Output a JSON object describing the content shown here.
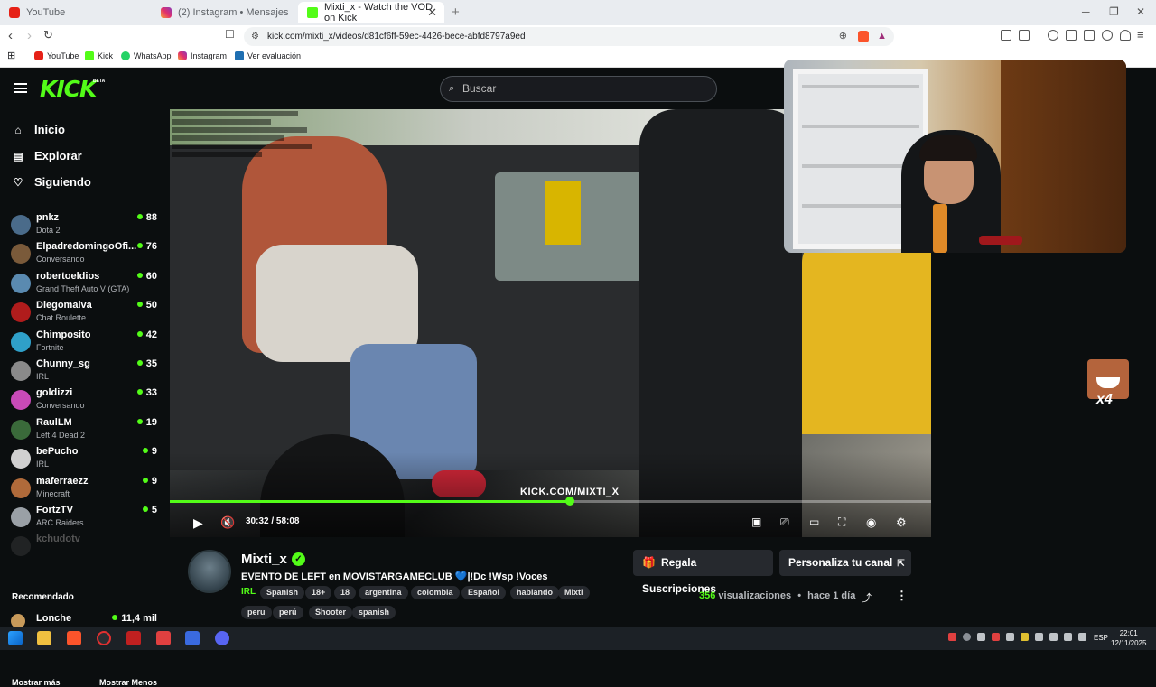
{
  "browser": {
    "tabs": [
      {
        "title": "YouTube",
        "favicon": "youtube-icon"
      },
      {
        "title": "(2) Instagram • Mensajes",
        "favicon": "instagram-icon"
      },
      {
        "title": "Mixti_x - Watch the VOD on Kick",
        "favicon": "kick-icon",
        "active": true
      }
    ],
    "url": "kick.com/mixti_x/videos/d81cf6ff-59ec-4426-bece-abfd8797a9ed",
    "bookmarks": [
      {
        "label": "YouTube",
        "favicon": "youtube-icon"
      },
      {
        "label": "Kick",
        "favicon": "kick-icon"
      },
      {
        "label": "WhatsApp",
        "favicon": "whatsapp-icon"
      },
      {
        "label": "Instagram",
        "favicon": "instagram-icon"
      },
      {
        "label": "Ver evaluación",
        "favicon": "evaluation-icon"
      }
    ]
  },
  "kick": {
    "logo": "KICK",
    "beta": "BETA",
    "search_placeholder": "Buscar",
    "nav": [
      {
        "label": "Inicio",
        "icon": "home-icon"
      },
      {
        "label": "Explorar",
        "icon": "explore-icon"
      },
      {
        "label": "Siguiendo",
        "icon": "heart-icon"
      }
    ],
    "channels": [
      {
        "name": "pnkz",
        "category": "Dota 2",
        "viewers": "88",
        "color": "#4a6b8a"
      },
      {
        "name": "ElpadredomingoOfi...",
        "category": "Conversando",
        "viewers": "76",
        "color": "#7a5a3a"
      },
      {
        "name": "robertoeldios",
        "category": "Grand Theft Auto V (GTA)",
        "viewers": "60",
        "color": "#5a8ab0"
      },
      {
        "name": "Diegomalva",
        "category": "Chat Roulette",
        "viewers": "50",
        "color": "#b01c1c"
      },
      {
        "name": "Chimposito",
        "category": "Fortnite",
        "viewers": "42",
        "color": "#2fa0c9"
      },
      {
        "name": "Chunny_sg",
        "category": "IRL",
        "viewers": "35",
        "color": "#8a8a8a"
      },
      {
        "name": "goldizzi",
        "category": "Conversando",
        "viewers": "33",
        "color": "#c94ab8"
      },
      {
        "name": "RaulLM",
        "category": "Left 4 Dead 2",
        "viewers": "19",
        "color": "#3a6a3a"
      },
      {
        "name": "bePucho",
        "category": "IRL",
        "viewers": "9",
        "color": "#d0d0d0"
      },
      {
        "name": "maferraezz",
        "category": "Minecraft",
        "viewers": "9",
        "color": "#b06a3a"
      },
      {
        "name": "FortzTV",
        "category": "ARC Raiders",
        "viewers": "5",
        "color": "#9aa0a6"
      },
      {
        "name": "kchudotv",
        "category": "",
        "viewers": "",
        "color": "#555555",
        "offline": true
      }
    ],
    "show_more": "Mostrar más",
    "show_less": "Mostrar Menos",
    "recommended_heading": "Recomendado",
    "recommended": {
      "name": "Lonche",
      "viewers": "11,4 mil",
      "color": "#c89a5a"
    }
  },
  "player": {
    "time_current": "30:32",
    "time_total": "58:08",
    "progress": 0.525,
    "watermark": "KICK.COM/MIXTI_X"
  },
  "vod": {
    "streamer": "Mixti_x",
    "title_prefix": "EVENTO DE LEFT en MOVISTARGAMECLUB",
    "title_heart": "💙",
    "title_suffix": "|!Dc !Wsp !Voces",
    "category": "IRL",
    "tags": [
      "Spanish",
      "18+",
      "18",
      "argentina",
      "colombia",
      "Español",
      "hablando",
      "Mixti",
      "peru",
      "perú",
      "Shooter",
      "spanish"
    ],
    "gift_button": "Regala Suscripciones",
    "customize_button": "Personaliza tu canal",
    "views_number": "356",
    "views_label": "visualizaciones",
    "age": "hace 1 día"
  },
  "overlay": {
    "emote_count": "x4"
  },
  "taskbar": {
    "language": "ESP",
    "time": "22:01",
    "date": "12/11/2025"
  }
}
